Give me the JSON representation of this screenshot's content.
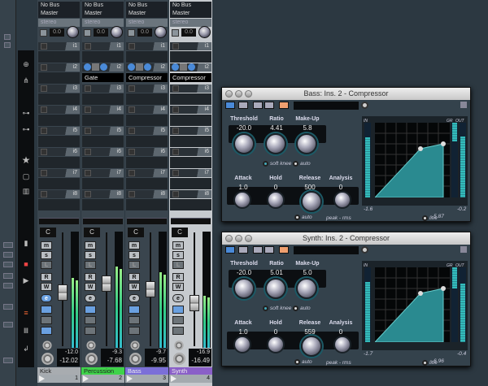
{
  "mixer": {
    "channels": [
      {
        "output": "No Bus",
        "input": "Master",
        "stereo": "stereo",
        "pan_value": "0.0",
        "inserts": [
          "i1",
          "i2",
          "i3",
          "i4",
          "i5",
          "i6",
          "i7",
          "i8"
        ],
        "insert2_plugin": "",
        "pan": "C",
        "buttons": [
          "m",
          "s",
          "L",
          "R",
          "W",
          "e"
        ],
        "volume": "-12.0",
        "peak": "-12.02",
        "name": "Kick",
        "number": "1",
        "color": "#a8acb0",
        "fader_level": 0.47,
        "meter_level": 0.6
      },
      {
        "output": "No Bus",
        "input": "Master",
        "stereo": "stereo",
        "pan_value": "0.0",
        "inserts": [
          "i1",
          "i2",
          "i3",
          "i4",
          "i5",
          "i6",
          "i7",
          "i8"
        ],
        "insert2_plugin": "Gate",
        "pan": "C",
        "buttons": [
          "m",
          "s",
          "L",
          "R",
          "W",
          "e"
        ],
        "volume": "-9.3",
        "peak": "-7.68",
        "name": "Percussion",
        "number": "2",
        "color": "#3fd34a",
        "fader_level": 0.55,
        "meter_level": 0.7
      },
      {
        "output": "No Bus",
        "input": "Master",
        "stereo": "stereo",
        "pan_value": "0.0",
        "inserts": [
          "i1",
          "i2",
          "i3",
          "i4",
          "i5",
          "i6",
          "i7",
          "i8"
        ],
        "insert2_plugin": "Compressor",
        "pan": "C",
        "buttons": [
          "m",
          "s",
          "L",
          "R",
          "W",
          "e"
        ],
        "volume": "-9.7",
        "peak": "-9.95",
        "name": "Bass",
        "number": "3",
        "color": "#7b6fd8",
        "fader_level": 0.5,
        "meter_level": 0.65
      },
      {
        "output": "No Bus",
        "input": "Master",
        "stereo": "stereo",
        "pan_value": "0.0",
        "inserts": [
          "i1",
          "i2",
          "i3",
          "i4",
          "i5",
          "i6",
          "i7",
          "i8"
        ],
        "insert2_plugin": "Compressor",
        "pan": "C",
        "buttons": [
          "m",
          "s",
          "L",
          "R",
          "W",
          "e"
        ],
        "volume": "-16.9",
        "peak": "-16.49",
        "name": "Synth",
        "number": "4",
        "color": "#8a5fc8",
        "fader_level": 0.38,
        "meter_level": 0.45
      }
    ]
  },
  "plugins": [
    {
      "title": "Bass: Ins. 2 - Compressor",
      "labels": [
        "Threshold",
        "Ratio",
        "Make-Up",
        "Attack",
        "Hold",
        "Release",
        "Analysis"
      ],
      "values": [
        "-20.0",
        "4.41",
        "5.8",
        "1.0",
        "0",
        "500",
        "0"
      ],
      "soft_knee": "soft knee",
      "auto1": "auto",
      "auto2": "auto",
      "peak_rms": "peak - rms",
      "live": "live",
      "in_label": "IN",
      "gr_label": "GR",
      "out_label": "OUT",
      "in_value": "-1.6",
      "gr_value": "-5.87",
      "out_value": "-0.2",
      "in_level": 0.8,
      "gr_level": 0.25,
      "out_level": 0.82
    },
    {
      "title": "Synth: Ins. 2 - Compressor",
      "labels": [
        "Threshold",
        "Ratio",
        "Make-Up",
        "Attack",
        "Hold",
        "Release",
        "Analysis"
      ],
      "values": [
        "-20.0",
        "5.01",
        "5.0",
        "1.0",
        "0",
        "559",
        "0"
      ],
      "soft_knee": "soft knee",
      "auto1": "auto",
      "auto2": "auto",
      "peak_rms": "peak - rms",
      "live": "live",
      "in_label": "IN",
      "gr_label": "GR",
      "out_label": "OUT",
      "in_value": "-1.7",
      "gr_value": "-6.96",
      "out_value": "-0.4",
      "in_level": 0.8,
      "gr_level": 0.28,
      "out_level": 0.78
    }
  ]
}
